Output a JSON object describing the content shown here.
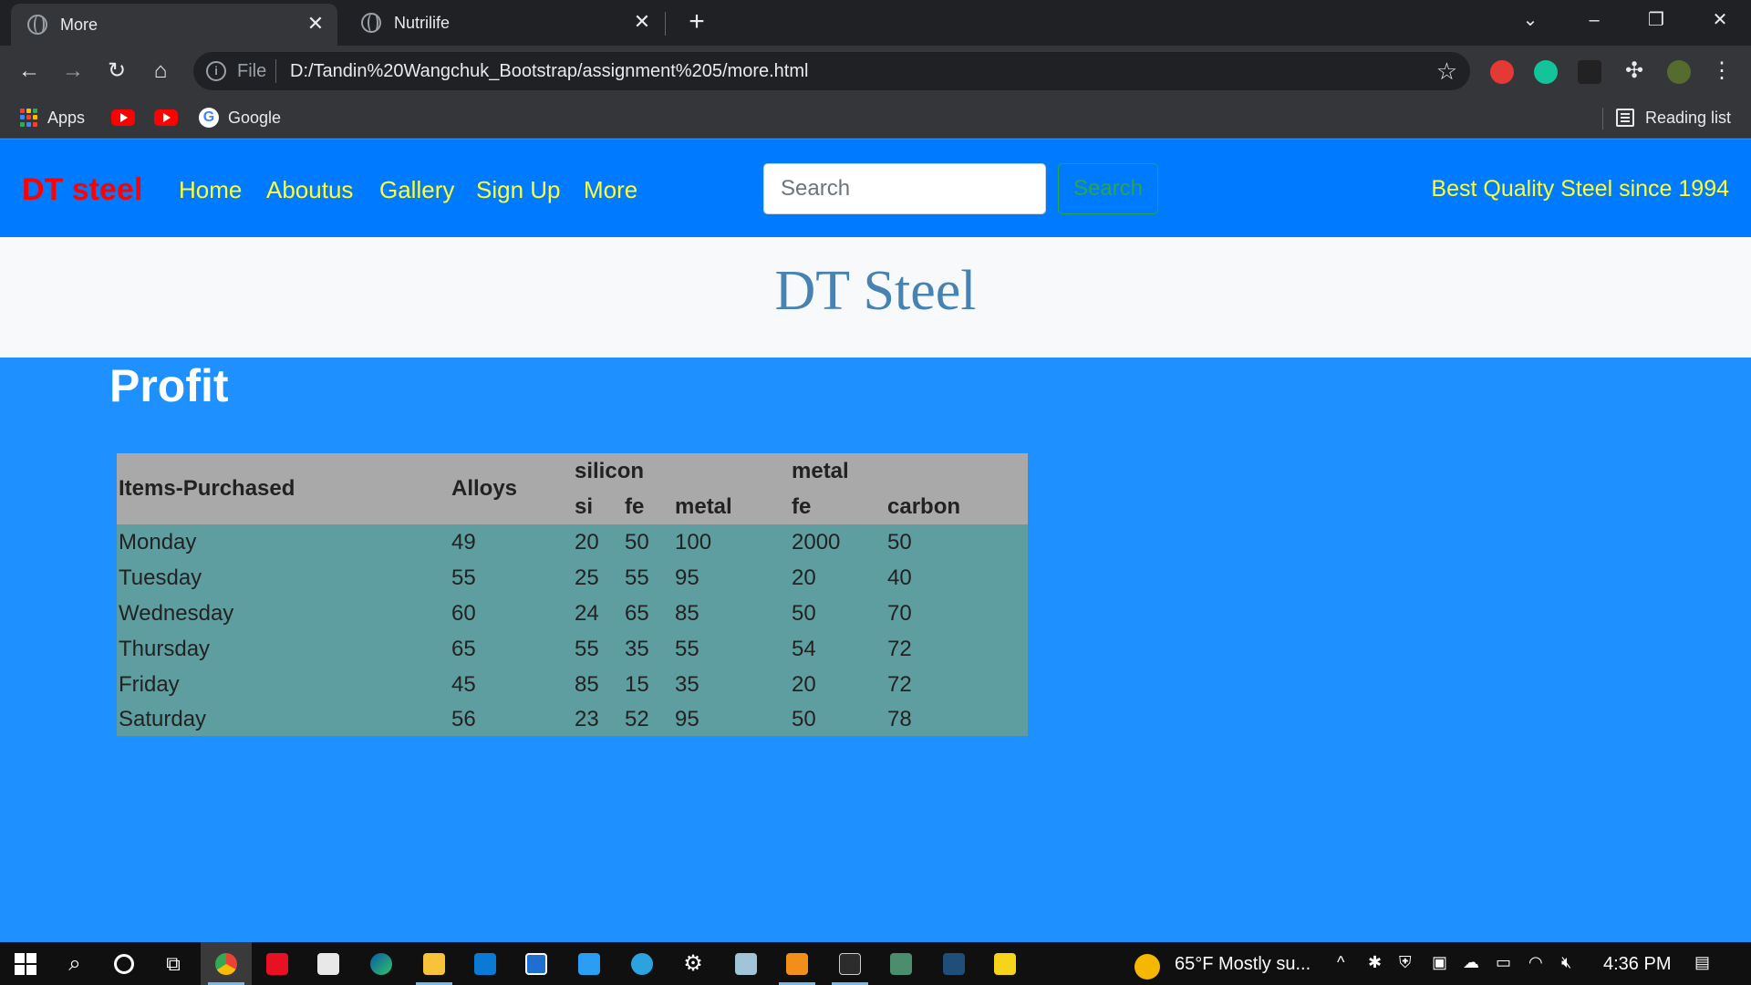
{
  "browser": {
    "tabs": [
      {
        "title": "More",
        "active": true
      },
      {
        "title": "Nutrilife",
        "active": false
      }
    ],
    "address": {
      "scheme_label": "File",
      "url": "D:/Tandin%20Wangchuk_Bootstrap/assignment%205/more.html"
    },
    "bookmarks": {
      "apps_label": "Apps",
      "google_label": "Google",
      "reading_list_label": "Reading list"
    }
  },
  "navbar": {
    "brand": "DT steel",
    "links": [
      "Home",
      "Aboutus",
      "Gallery",
      "Sign Up",
      "More"
    ],
    "search_placeholder": "Search",
    "search_button": "Search",
    "tagline": "Best Quality Steel since 1994"
  },
  "jumbotron": {
    "title": "DT Steel"
  },
  "section": {
    "heading": "Profit"
  },
  "table": {
    "header_top": {
      "items": "Items-Purchased",
      "alloys": "Alloys",
      "silicon": "silicon",
      "metal": "metal"
    },
    "header_sub": [
      "si",
      "fe",
      "metal",
      "fe",
      "carbon"
    ],
    "rows": [
      [
        "Monday",
        "49",
        "20",
        "50",
        "100",
        "2000",
        "50"
      ],
      [
        "Tuesday",
        "55",
        "25",
        "55",
        "95",
        "20",
        "40"
      ],
      [
        "Wednesday",
        "60",
        "24",
        "65",
        "85",
        "50",
        "70"
      ],
      [
        "Thursday",
        "65",
        "55",
        "35",
        "55",
        "54",
        "72"
      ],
      [
        "Friday",
        "45",
        "85",
        "15",
        "35",
        "20",
        "72"
      ],
      [
        "Saturday",
        "56",
        "23",
        "52",
        "95",
        "50",
        "78"
      ]
    ]
  },
  "taskbar": {
    "weather": "65°F  Mostly su...",
    "time": "4:36 PM"
  },
  "colors": {
    "navbar_bg": "#007bff",
    "page_bg": "#1e90ff",
    "brand": "#ff0000",
    "nav_link": "#ffff33",
    "table_head": "#a9a9a9",
    "table_body": "#5f9ea0",
    "jumbo_title": "#4682b4"
  }
}
